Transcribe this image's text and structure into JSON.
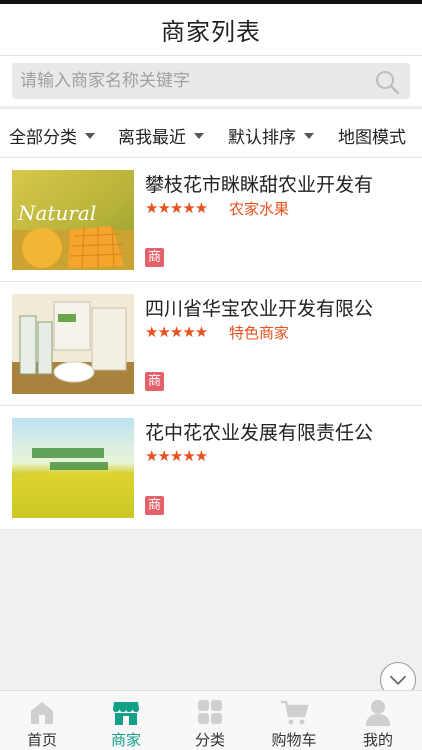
{
  "header": {
    "title": "商家列表"
  },
  "search": {
    "placeholder": "请输入商家名称关键字",
    "icon": "search-icon"
  },
  "filters": [
    {
      "label": "全部分类"
    },
    {
      "label": "离我最近"
    },
    {
      "label": "默认排序"
    },
    {
      "label": "地图模式"
    }
  ],
  "merchants": [
    {
      "name": "攀枝花市眯眯甜农业开发有",
      "rating": 5,
      "stars": "★★★★★",
      "category": "农家水果",
      "badge": "商",
      "image_text": "Natural"
    },
    {
      "name": "四川省华宝农业开发有限公",
      "rating": 5,
      "stars": "★★★★★",
      "category": "特色商家",
      "badge": "商",
      "image_text": ""
    },
    {
      "name": "花中花农业发展有限责任公",
      "rating": 5,
      "stars": "★★★★★",
      "category": "",
      "badge": "商",
      "image_text": ""
    }
  ],
  "tabbar": [
    {
      "label": "首页",
      "icon": "home-icon",
      "active": false
    },
    {
      "label": "商家",
      "icon": "shop-icon",
      "active": true
    },
    {
      "label": "分类",
      "icon": "grid-icon",
      "active": false
    },
    {
      "label": "购物车",
      "icon": "cart-icon",
      "active": false
    },
    {
      "label": "我的",
      "icon": "user-icon",
      "active": false
    }
  ],
  "colors": {
    "accent": "#12a089",
    "star": "#e8501d",
    "badge": "#e4606a"
  }
}
